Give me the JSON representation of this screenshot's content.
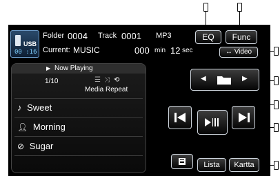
{
  "device": {
    "source": "USB",
    "elapsed": "00 :16"
  },
  "header": {
    "folder_label": "Folder",
    "folder_num": "0004",
    "track_label": "Track",
    "track_num": "0001",
    "format": "MP3",
    "current_label": "Current:",
    "current_value": "MUSIC",
    "time_min": "000",
    "min_label": "min",
    "time_sec": "12",
    "sec_label": "sec"
  },
  "buttons": {
    "eq": "EQ",
    "func": "Func",
    "video": "Video",
    "lista": "Lista",
    "kartta": "Kartta"
  },
  "now_playing": {
    "title": "Now Playing",
    "count": "1/10",
    "repeat_label": "Media Repeat"
  },
  "info_rows": [
    {
      "icon": "music-note-icon",
      "text": "Sweet"
    },
    {
      "icon": "person-icon",
      "text": "Morning"
    },
    {
      "icon": "disc-icon",
      "text": "Sugar"
    }
  ],
  "colors": {
    "screen": "#000000",
    "accent_blue": "#6fa0d0",
    "text": "#ffffff"
  }
}
